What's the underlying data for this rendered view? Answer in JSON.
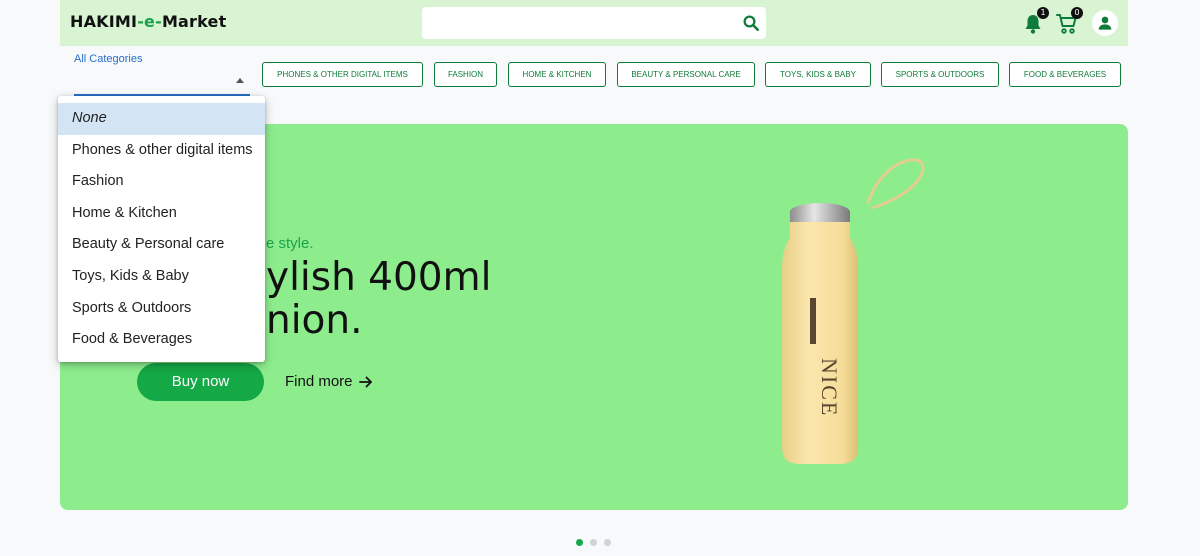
{
  "header": {
    "logo_part1": "HAKIMI",
    "logo_part2": "-e-",
    "logo_part3": "Market",
    "search": {
      "placeholder": "",
      "icon": "search-icon"
    },
    "notifications": {
      "icon": "bell-icon",
      "count": "1"
    },
    "cart": {
      "icon": "cart-icon",
      "count": "0"
    },
    "account": {
      "icon": "user-icon"
    }
  },
  "category_select": {
    "label": "All Categories",
    "value": "",
    "options": [
      "None",
      "Phones & other digital items",
      "Fashion",
      "Home & Kitchen",
      "Beauty & Personal care",
      "Toys, Kids & Baby",
      "Sports & Outdoors",
      "Food & Beverages"
    ],
    "highlighted_index": 0
  },
  "category_buttons": [
    "PHONES & OTHER DIGITAL ITEMS",
    "FASHION",
    "HOME & KITCHEN",
    "BEAUTY & PERSONAL CARE",
    "TOYS, KIDS & BABY",
    "SPORTS & OUTDOORS",
    "FOOD & BEVERAGES"
  ],
  "hero": {
    "tagline_visible": "e style.",
    "title_line1_visible": "ylish 400ml",
    "title_line2_visible": "nion.",
    "buy_label": "Buy now",
    "find_more_label": "Find more",
    "product_text": "NICE",
    "background": "#8ded8d"
  },
  "carousel": {
    "slides": 3,
    "active": 1
  },
  "colors": {
    "accent": "#14a846",
    "header_bg": "#d8f4d2",
    "button_border": "#0f7b3a",
    "select_blue": "#2a6fc9"
  }
}
